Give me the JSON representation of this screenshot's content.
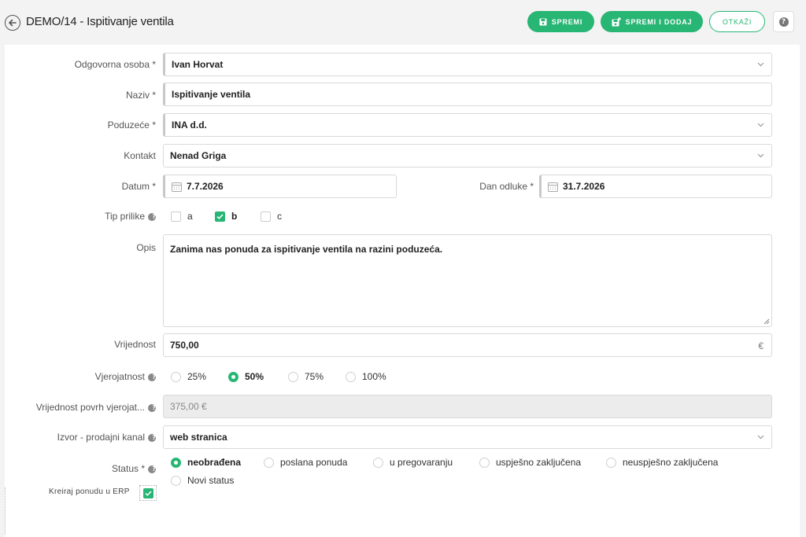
{
  "header": {
    "title": "DEMO/14 - Ispitivanje ventila",
    "save_label": "SPREMI",
    "save_add_label": "SPREMI I DODAJ",
    "cancel_label": "OTKAŽI",
    "help_label": "?"
  },
  "form": {
    "responsible": {
      "label": "Odgovorna osoba *",
      "value": "Ivan Horvat"
    },
    "name": {
      "label": "Naziv *",
      "value": "Ispitivanje ventila"
    },
    "company": {
      "label": "Poduzeće *",
      "value": "INA d.d."
    },
    "contact": {
      "label": "Kontakt",
      "value": "Nenad Griga"
    },
    "date": {
      "label": "Datum *",
      "value": "7.7.2026"
    },
    "decision_date": {
      "label": "Dan odluke *",
      "value": "31.7.2026"
    },
    "opportunity_type": {
      "label": "Tip prilike",
      "options": [
        {
          "label": "a",
          "checked": false
        },
        {
          "label": "b",
          "checked": true
        },
        {
          "label": "c",
          "checked": false
        }
      ]
    },
    "description": {
      "label": "Opis",
      "value": "Zanima nas ponuda za ispitivanje ventila na razini poduzeća."
    },
    "value": {
      "label": "Vrijednost",
      "value": "750,00",
      "currency": "€"
    },
    "probability": {
      "label": "Vjerojatnost",
      "options": [
        {
          "label": "25%",
          "selected": false
        },
        {
          "label": "50%",
          "selected": true
        },
        {
          "label": "75%",
          "selected": false
        },
        {
          "label": "100%",
          "selected": false
        }
      ]
    },
    "weighted_value": {
      "label": "Vrijednost povrh vjerojat...",
      "value": "375,00 €"
    },
    "source": {
      "label": "Izvor - prodajni kanal",
      "value": "web stranica"
    },
    "status": {
      "label": "Status *",
      "options": [
        {
          "label": "neobrađena",
          "selected": true
        },
        {
          "label": "poslana ponuda",
          "selected": false
        },
        {
          "label": "u pregovaranju",
          "selected": false
        },
        {
          "label": "uspješno zaključena",
          "selected": false
        },
        {
          "label": "neuspješno zaključena",
          "selected": false
        },
        {
          "label": "Novi status",
          "selected": false
        }
      ]
    },
    "erp": {
      "label": "Kreiraj ponudu u ERP",
      "checked": true
    }
  },
  "colors": {
    "accent": "#28b674"
  },
  "icons": [
    "back-arrow-icon",
    "save-icon",
    "save-add-icon",
    "help-icon",
    "chevron-down-icon",
    "calendar-icon",
    "check-icon"
  ]
}
